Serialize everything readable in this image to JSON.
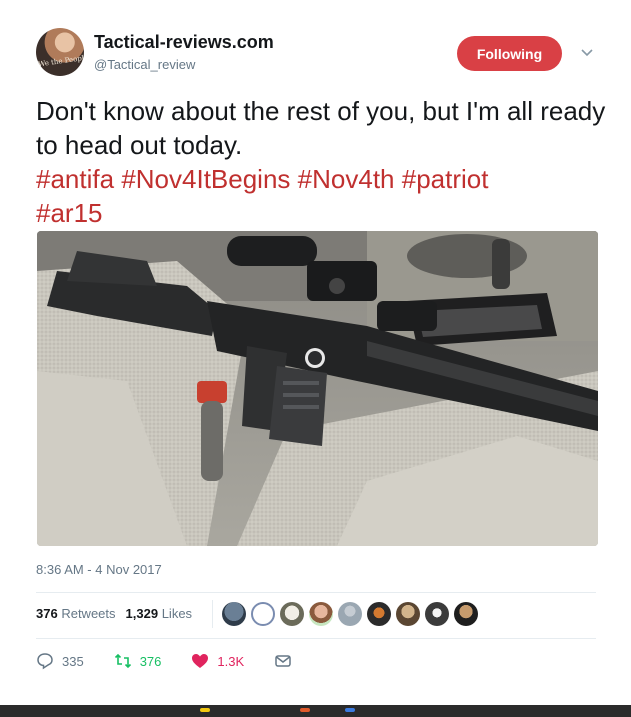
{
  "tweet": {
    "display_name": "Tactical-reviews.com",
    "handle": "@Tactical_review",
    "avatar_text": "We the People",
    "follow_label": "Following",
    "text_plain": "Don't know about the rest of you, but I'm all ready to head out today.",
    "hashtags": [
      "#antifa",
      "#Nov4ItBegins",
      "#Nov4th",
      "#patriot",
      "#ar15"
    ],
    "timestamp": "8:36 AM - 4 Nov 2017",
    "retweets_count": "376",
    "retweets_label": "Retweets",
    "likes_count": "1,329",
    "likes_label": "Likes",
    "reply_count": "335",
    "retweet_action_count": "376",
    "like_action_count": "1.3K"
  },
  "colors": {
    "follow_button": "#d94045",
    "hashtag": "#c0302f",
    "retweet": "#17bf63",
    "like": "#e0245e",
    "muted": "#657786"
  },
  "icons": {
    "caret": "chevron-down-icon",
    "reply": "reply-icon",
    "retweet": "retweet-icon",
    "like": "heart-icon",
    "message": "envelope-icon"
  }
}
